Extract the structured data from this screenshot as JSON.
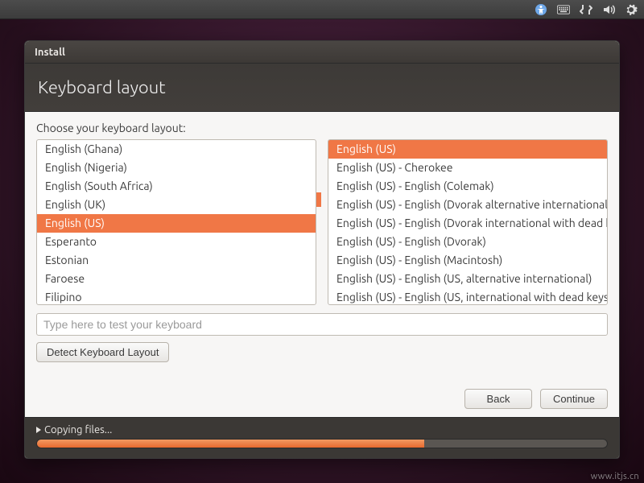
{
  "menubar": {
    "icons": [
      "accessibility",
      "keyboard",
      "network",
      "volume",
      "settings"
    ]
  },
  "window": {
    "title": "Install",
    "header": "Keyboard layout"
  },
  "prompt": "Choose your keyboard layout:",
  "languages": {
    "items": [
      "English (Ghana)",
      "English (Nigeria)",
      "English (South Africa)",
      "English (UK)",
      "English (US)",
      "Esperanto",
      "Estonian",
      "Faroese",
      "Filipino"
    ],
    "selected_index": 4
  },
  "variants": {
    "items": [
      "English (US)",
      "English (US) - Cherokee",
      "English (US) - English (Colemak)",
      "English (US) - English (Dvorak alternative international no dead keys)",
      "English (US) - English (Dvorak international with dead keys)",
      "English (US) - English (Dvorak)",
      "English (US) - English (Macintosh)",
      "English (US) - English (US, alternative international)",
      "English (US) - English (US, international with dead keys)"
    ],
    "selected_index": 0
  },
  "test_placeholder": "Type here to test your keyboard",
  "buttons": {
    "detect": "Detect Keyboard Layout",
    "back": "Back",
    "continue": "Continue"
  },
  "progress": {
    "label": "Copying files...",
    "percent": 68
  },
  "watermark": "www.itjs.cn"
}
